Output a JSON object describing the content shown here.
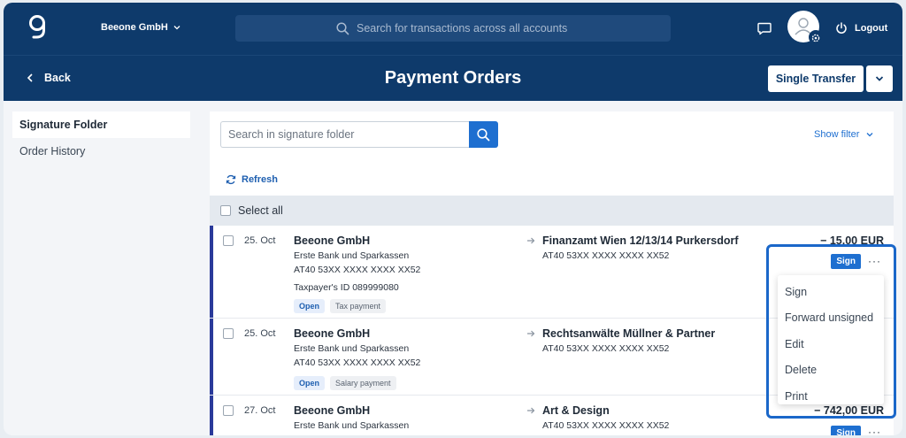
{
  "topbar": {
    "company": "Beeone GmbH",
    "search_placeholder": "Search for transactions across all accounts",
    "logout": "Logout"
  },
  "header": {
    "back": "Back",
    "title": "Payment Orders",
    "single_transfer": "Single Transfer"
  },
  "sidebar": {
    "items": [
      {
        "label": "Signature Folder"
      },
      {
        "label": "Order History"
      }
    ]
  },
  "main": {
    "search_placeholder": "Search in signature folder",
    "show_filter": "Show filter",
    "refresh": "Refresh",
    "select_all": "Select all",
    "orders": [
      {
        "date": "25. Oct",
        "payer": "Beeone GmbH",
        "bank": "Erste Bank und Sparkassen",
        "iban": "AT40 53XX XXXX XXXX XX52",
        "extra": "Taxpayer's ID 089999080",
        "status": "Open",
        "type": "Tax payment",
        "payee": "Finanzamt Wien 12/13/14 Purkersdorf",
        "payee_iban": "AT40 53XX XXXX XXXX XX52",
        "amount": "− 15,00 EUR",
        "sign": "Sign"
      },
      {
        "date": "25. Oct",
        "payer": "Beeone GmbH",
        "bank": "Erste Bank und Sparkassen",
        "iban": "AT40 53XX XXXX XXXX XX52",
        "status": "Open",
        "type": "Salary payment",
        "payee": "Rechtsanwälte Müllner & Partner",
        "payee_iban": "AT40 53XX XXXX XXXX XX52"
      },
      {
        "date": "27. Oct",
        "payer": "Beeone GmbH",
        "bank": "Erste Bank und Sparkassen",
        "payee": "Art & Design",
        "payee_iban": "AT40 53XX XXXX XXXX XX52",
        "amount": "− 742,00 EUR",
        "sign": "Sign"
      }
    ]
  },
  "context_menu": {
    "items": [
      "Sign",
      "Forward unsigned",
      "Edit",
      "Delete",
      "Print"
    ]
  },
  "colors": {
    "brand_navy": "#0e3a6b",
    "accent_blue": "#1e6fd0",
    "row_marker": "#2a3a9a"
  }
}
